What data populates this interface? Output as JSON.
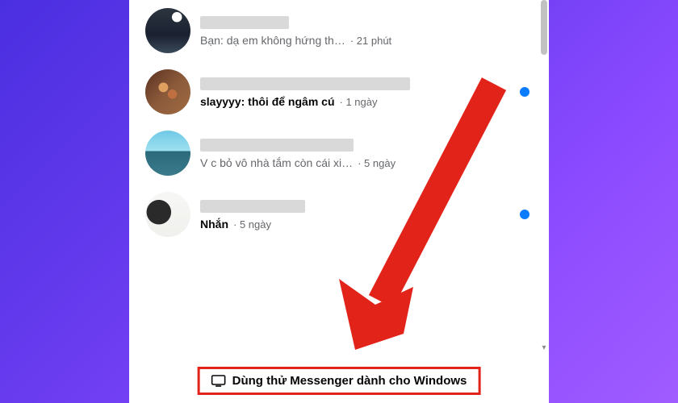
{
  "chats": [
    {
      "preview": "Bạn: dạ em không hứng th…",
      "time": "21 phút",
      "unread": false,
      "redact_w": 110
    },
    {
      "preview": "slayyyy: thôi để ngâm cú",
      "time": "1 ngày",
      "unread": true,
      "redact_w": 260
    },
    {
      "preview": "V c bỏ vô nhà tắm còn cái xi…",
      "time": "5 ngày",
      "unread": false,
      "redact_w": 190
    },
    {
      "preview": "Nhắn",
      "time": "5 ngày",
      "unread": true,
      "redact_w": 130
    }
  ],
  "banner": {
    "text": "Dùng thử Messenger dành cho Windows"
  }
}
